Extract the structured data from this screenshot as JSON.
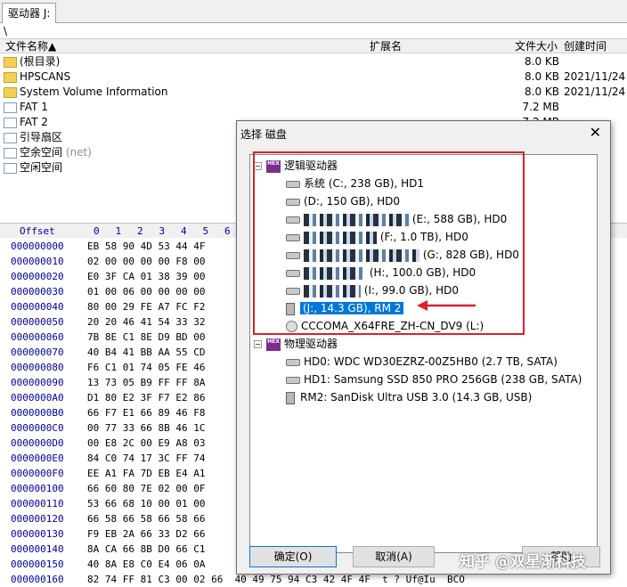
{
  "tab": {
    "label": "驱动器 J:"
  },
  "path": "\\",
  "file_headers": {
    "name": "文件名称▲",
    "ext": "扩展名",
    "size": "文件大小",
    "created": "创建时间"
  },
  "files": [
    {
      "icon": "folder-icon",
      "name": "(根目录)",
      "ext": "",
      "size": "8.0 KB",
      "created": "",
      "note": ""
    },
    {
      "icon": "folder-icon",
      "name": "HPSCANS",
      "ext": "",
      "size": "8.0 KB",
      "created": "2021/11/24",
      "note": ""
    },
    {
      "icon": "folder-icon",
      "name": "System Volume Information",
      "ext": "",
      "size": "8.0 KB",
      "created": "2021/11/24",
      "note": ""
    },
    {
      "icon": "file-icon",
      "name": "FAT 1",
      "ext": "",
      "size": "7.2 MB",
      "created": "",
      "note": ""
    },
    {
      "icon": "file-icon",
      "name": "FAT 2",
      "ext": "",
      "size": "7.2 MB",
      "created": "",
      "note": ""
    },
    {
      "icon": "file-icon",
      "name": "引导扇区",
      "ext": "",
      "size": "",
      "created": "",
      "note": ""
    },
    {
      "icon": "file-icon",
      "name": "空余空间",
      "ext": "",
      "size": "",
      "created": "",
      "note": "(net)"
    },
    {
      "icon": "file-icon",
      "name": "空闲空间",
      "ext": "",
      "size": "",
      "created": "",
      "note": ""
    }
  ],
  "hex": {
    "offset_label": "Offset",
    "columns": [
      "0",
      "1",
      "2",
      "3",
      "4",
      "5",
      "6"
    ],
    "rows": [
      {
        "offset": "000000000",
        "bytes": "EB 58 90 4D 53 44 4F"
      },
      {
        "offset": "000000010",
        "bytes": "02 00 00 00 00 F8 00"
      },
      {
        "offset": "000000020",
        "bytes": "E0 3F CA 01 38 39 00"
      },
      {
        "offset": "000000030",
        "bytes": "01 00 06 00 00 00 00"
      },
      {
        "offset": "000000040",
        "bytes": "80 00 29 FE A7 FC F2"
      },
      {
        "offset": "000000050",
        "bytes": "20 20 46 41 54 33 32"
      },
      {
        "offset": "000000060",
        "bytes": "7B 8E C1 8E D9 BD 00"
      },
      {
        "offset": "000000070",
        "bytes": "40 B4 41 BB AA 55 CD"
      },
      {
        "offset": "000000080",
        "bytes": "F6 C1 01 74 05 FE 46"
      },
      {
        "offset": "000000090",
        "bytes": "13 73 05 B9 FF FF 8A"
      },
      {
        "offset": "0000000A0",
        "bytes": "D1 80 E2 3F F7 E2 86"
      },
      {
        "offset": "0000000B0",
        "bytes": "66 F7 E1 66 89 46 F8"
      },
      {
        "offset": "0000000C0",
        "bytes": "00 77 33 66 8B 46 1C"
      },
      {
        "offset": "0000000D0",
        "bytes": "00 E8 2C 00 E9 A8 03"
      },
      {
        "offset": "0000000E0",
        "bytes": "84 C0 74 17 3C FF 74"
      },
      {
        "offset": "0000000F0",
        "bytes": "EE A1 FA 7D EB E4 A1"
      },
      {
        "offset": "000000100",
        "bytes": "66 60 80 7E 02 00 0F"
      },
      {
        "offset": "000000110",
        "bytes": "53 66 68 10 00 01 00"
      },
      {
        "offset": "000000120",
        "bytes": "66 58 66 58 66 58 66"
      },
      {
        "offset": "000000130",
        "bytes": "F9 EB 2A 66 33 D2 66"
      },
      {
        "offset": "000000140",
        "bytes": "8A CA 66 8B D0 66 C1"
      },
      {
        "offset": "000000150",
        "bytes": "40 8A E8 C0 E4 06 0A"
      },
      {
        "offset": "000000160",
        "bytes": "82 74 FF 81 C3 00 02 66  40 49 75 94 C3 42 4F 4F  t ? Uf@Iu  BCO"
      }
    ]
  },
  "dialog": {
    "title": "选择 磁盘",
    "close_symbol": "✕",
    "logical_group": "逻辑驱动器",
    "logical_drives": [
      {
        "label": "系统 (C:, 238 GB), HD1",
        "kind": "disk",
        "redacted": false,
        "selected": false
      },
      {
        "label": "(D:, 150 GB), HD0",
        "kind": "disk",
        "redacted": false,
        "selected": false
      },
      {
        "label": "(E:, 588 GB), HD0",
        "kind": "disk",
        "redacted": true,
        "selected": false
      },
      {
        "label": "(F:, 1.0 TB), HD0",
        "kind": "disk",
        "redacted": true,
        "selected": false
      },
      {
        "label": "(G:, 828 GB), HD0",
        "kind": "disk",
        "redacted": true,
        "selected": false
      },
      {
        "label": "(H:, 100.0 GB), HD0",
        "kind": "disk",
        "redacted": true,
        "selected": false
      },
      {
        "label": "(I:, 99.0 GB), HD0",
        "kind": "disk",
        "redacted": true,
        "selected": false
      },
      {
        "label": "(J:, 14.3 GB), RM 2",
        "kind": "usb",
        "redacted": false,
        "selected": true
      },
      {
        "label": "CCCOMA_X64FRE_ZH-CN_DV9 (L:)",
        "kind": "cd",
        "redacted": false,
        "selected": false
      }
    ],
    "physical_group": "物理驱动器",
    "physical_drives": [
      {
        "label": "HD0: WDC WD30EZRZ-00Z5HB0 (2.7 TB, SATA)",
        "kind": "disk"
      },
      {
        "label": "HD1: Samsung SSD 850 PRO 256GB (238 GB, SATA)",
        "kind": "disk"
      },
      {
        "label": "RM2: SanDisk Ultra USB 3.0 (14.3 GB, USB)",
        "kind": "usb"
      }
    ],
    "ok_label": "确定(O)",
    "cancel_label": "取消(A)",
    "help_label": "帮助"
  },
  "watermark": "知乎 @双星渐科技",
  "colors": {
    "selection": "#0078d7",
    "highlight_box": "#d9222a",
    "offset_text": "#0000a0"
  }
}
